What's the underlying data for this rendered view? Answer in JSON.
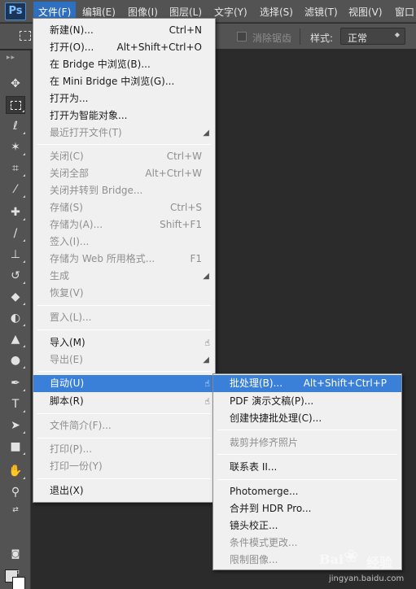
{
  "app": {
    "logo": "Ps"
  },
  "menubar": {
    "items": [
      "文件(F)",
      "编辑(E)",
      "图像(I)",
      "图层(L)",
      "文字(Y)",
      "选择(S)",
      "滤镜(T)",
      "视图(V)",
      "窗口"
    ],
    "active_index": 0
  },
  "options_bar": {
    "antialias_label": "消除锯齿",
    "style_label": "样式:",
    "style_value": "正常"
  },
  "toolbar": {
    "tools": [
      "move-icon",
      "rect-marquee-icon",
      "lasso-icon",
      "magic-wand-icon",
      "crop-icon",
      "eyedropper-icon",
      "healing-brush-icon",
      "brush-icon",
      "clone-stamp-icon",
      "history-brush-icon",
      "eraser-icon",
      "paint-bucket-icon",
      "blur-icon",
      "dodge-icon",
      "pen-icon",
      "type-icon",
      "path-selection-icon",
      "rectangle-icon",
      "hand-icon",
      "zoom-icon"
    ],
    "swatch_fg": "#e0e0e0",
    "swatch_bg": "#ffffff"
  },
  "file_menu": {
    "items": [
      {
        "label": "新建(N)...",
        "shortcut": "Ctrl+N",
        "enabled": true
      },
      {
        "label": "打开(O)...",
        "shortcut": "Alt+Shift+Ctrl+O",
        "enabled": true
      },
      {
        "label": "在 Bridge 中浏览(B)...",
        "shortcut": "",
        "enabled": true
      },
      {
        "label": "在 Mini Bridge 中浏览(G)...",
        "shortcut": "",
        "enabled": true
      },
      {
        "label": "打开为...",
        "shortcut": "",
        "enabled": true
      },
      {
        "label": "打开为智能对象...",
        "shortcut": "",
        "enabled": true
      },
      {
        "label": "最近打开文件(T)",
        "shortcut": "",
        "enabled": false,
        "submenu": true
      },
      {
        "label": "关闭(C)",
        "shortcut": "Ctrl+W",
        "enabled": false
      },
      {
        "label": "关闭全部",
        "shortcut": "Alt+Ctrl+W",
        "enabled": false
      },
      {
        "label": "关闭并转到 Bridge...",
        "shortcut": "",
        "enabled": false
      },
      {
        "label": "存储(S)",
        "shortcut": "Ctrl+S",
        "enabled": false
      },
      {
        "label": "存储为(A)...",
        "shortcut": "Shift+F1",
        "enabled": false
      },
      {
        "label": "签入(I)...",
        "shortcut": "",
        "enabled": false
      },
      {
        "label": "存储为 Web 所用格式...",
        "shortcut": "F1",
        "enabled": false
      },
      {
        "label": "生成",
        "shortcut": "",
        "enabled": false,
        "submenu": true
      },
      {
        "label": "恢复(V)",
        "shortcut": "",
        "enabled": false
      },
      {
        "label": "置入(L)...",
        "shortcut": "",
        "enabled": false
      },
      {
        "label": "导入(M)",
        "shortcut": "",
        "enabled": true,
        "submenu": true
      },
      {
        "label": "导出(E)",
        "shortcut": "",
        "enabled": false,
        "submenu": true
      },
      {
        "label": "自动(U)",
        "shortcut": "",
        "enabled": true,
        "submenu": true,
        "highlighted": true
      },
      {
        "label": "脚本(R)",
        "shortcut": "",
        "enabled": true,
        "submenu": true
      },
      {
        "label": "文件简介(F)...",
        "shortcut": "",
        "enabled": false
      },
      {
        "label": "打印(P)...",
        "shortcut": "",
        "enabled": false
      },
      {
        "label": "打印一份(Y)",
        "shortcut": "",
        "enabled": false
      },
      {
        "label": "退出(X)",
        "shortcut": "",
        "enabled": true
      }
    ]
  },
  "automate_submenu": {
    "items": [
      {
        "label": "批处理(B)...",
        "shortcut": "Alt+Shift+Ctrl+P",
        "enabled": true,
        "highlighted": true
      },
      {
        "label": "PDF 演示文稿(P)...",
        "shortcut": "",
        "enabled": true
      },
      {
        "label": "创建快捷批处理(C)...",
        "shortcut": "",
        "enabled": true
      },
      {
        "label": "裁剪并修齐照片",
        "shortcut": "",
        "enabled": false
      },
      {
        "label": "联系表 II...",
        "shortcut": "",
        "enabled": true
      },
      {
        "label": "Photomerge...",
        "shortcut": "",
        "enabled": true
      },
      {
        "label": "合并到 HDR Pro...",
        "shortcut": "",
        "enabled": true
      },
      {
        "label": "镜头校正...",
        "shortcut": "",
        "enabled": true
      },
      {
        "label": "条件模式更改...",
        "shortcut": "",
        "enabled": false
      },
      {
        "label": "限制图像...",
        "shortcut": "",
        "enabled": false
      }
    ]
  },
  "watermark": {
    "brand": "Bai",
    "brand2": "经验",
    "url": "jingyan.baidu.com"
  }
}
